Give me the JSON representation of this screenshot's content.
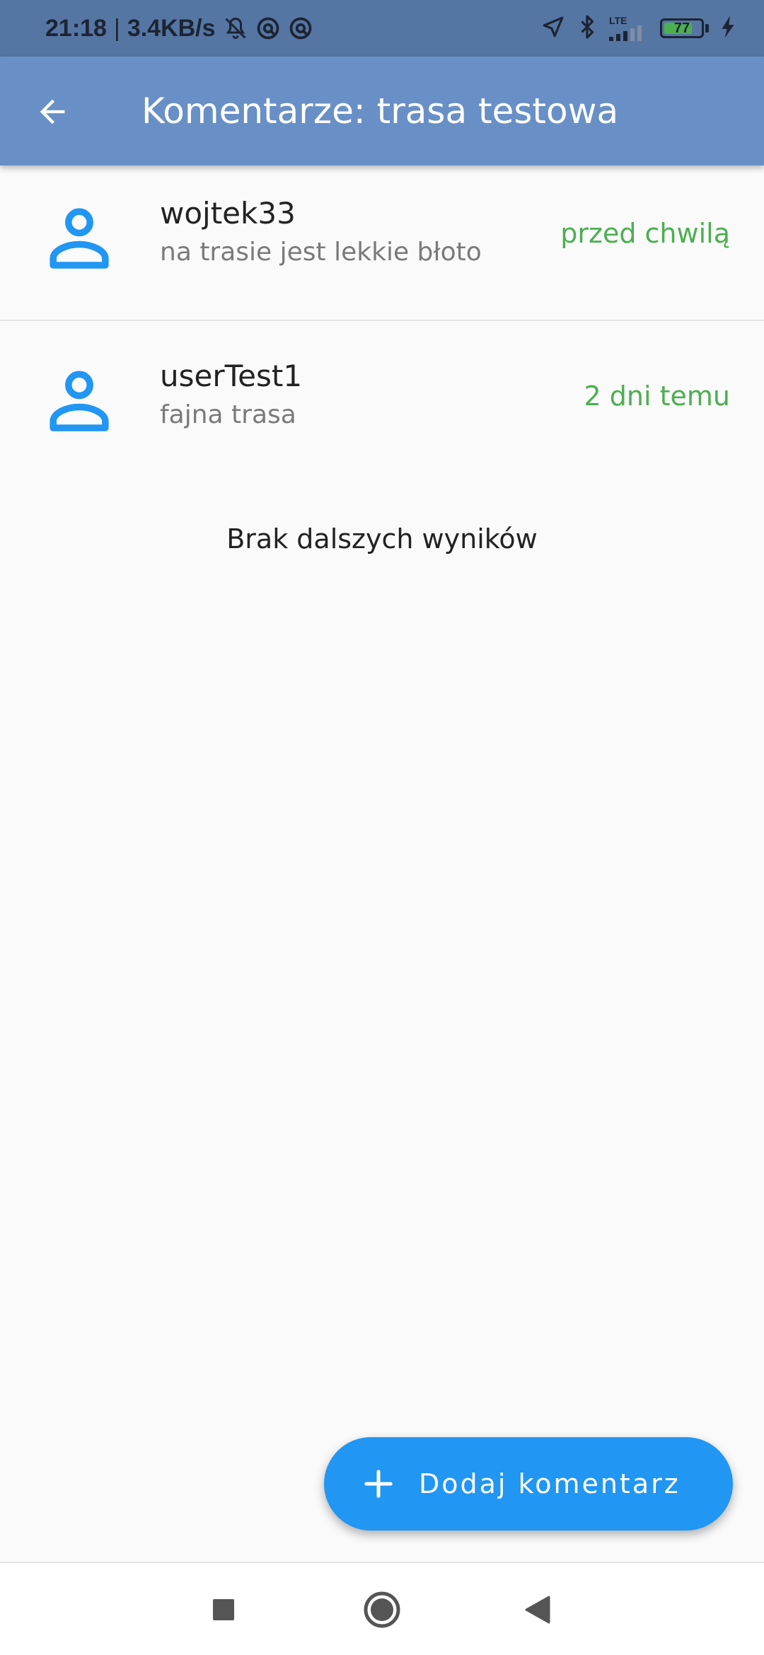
{
  "status_bar": {
    "time": "21:18",
    "separator": "|",
    "network_speed": "3.4KB/s",
    "network_type": "LTE",
    "battery_level": "77",
    "battery_fraction": 0.77,
    "icons": [
      "notifications-off-icon",
      "app-icon",
      "app-icon",
      "location-arrow-icon",
      "bluetooth-icon",
      "signal-icon",
      "battery-icon",
      "charging-icon"
    ]
  },
  "app_bar": {
    "title": "Komentarze: trasa testowa",
    "back_icon": "arrow-back-icon"
  },
  "comments": [
    {
      "user": "wojtek33",
      "text": "na trasie jest lekkie błoto",
      "time": "przed chwilą",
      "avatar_icon": "person-icon"
    },
    {
      "user": "userTest1",
      "text": "fajna trasa",
      "time": "2 dni temu",
      "avatar_icon": "person-icon"
    }
  ],
  "list_footer": "Brak dalszych wyników",
  "fab": {
    "label": "Dodaj komentarz",
    "icon": "plus-icon"
  },
  "nav_bar": {
    "icons": [
      "recents-square-icon",
      "home-circle-icon",
      "back-triangle-icon"
    ]
  },
  "colors": {
    "status_bar": "#5576a3",
    "app_bar": "#6890c6",
    "accent_blue": "#2196f3",
    "time_green": "#4caf50",
    "background": "#fafafa"
  }
}
